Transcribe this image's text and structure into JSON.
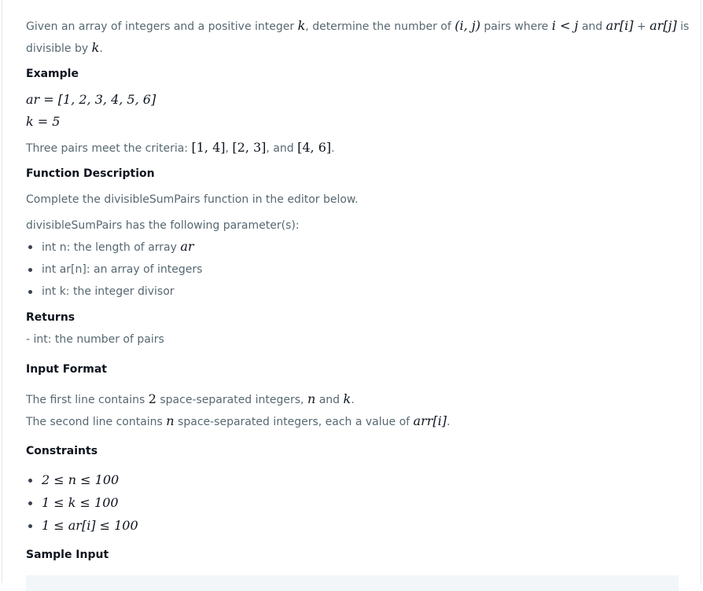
{
  "intro": {
    "t1": "Given an array of integers and a positive integer ",
    "k": "k",
    "t2": ", determine the number of ",
    "pair": "(i, j)",
    "t3": " pairs where ",
    "cond": "i < j",
    "t4": " and ",
    "ari": "ar[i]",
    "plus": " + ",
    "arj": "ar[j]",
    "t5": " is",
    "line2a": "divisible by ",
    "line2k": "k",
    "line2b": "."
  },
  "example": {
    "heading": "Example",
    "ar_line": "ar = [1, 2, 3, 4, 5, 6]",
    "k_line": "k = 5",
    "pairs_text": "Three pairs meet the criteria: ",
    "p1": "[1, 4]",
    "c1": ", ",
    "p2": "[2, 3]",
    "c2": ", and ",
    "p3": "[4, 6]",
    "end": "."
  },
  "function_description": {
    "heading": "Function Description",
    "text": "Complete the divisibleSumPairs function in the editor below.",
    "params_intro": "divisibleSumPairs has the following parameter(s):",
    "param1_text": "int n: the length of array ",
    "param1_var": "ar",
    "param2": "int ar[n]: an array of integers",
    "param3": "int k: the integer divisor"
  },
  "returns": {
    "heading": "Returns",
    "text": "- int: the number of pairs"
  },
  "input_format": {
    "heading": "Input Format",
    "l1a": "The first line contains ",
    "l1num": "2",
    "l1b": " space-separated integers, ",
    "l1n": "n",
    "l1c": " and ",
    "l1k": "k",
    "l1d": ".",
    "l2a": "The second line contains ",
    "l2n": "n",
    "l2b": " space-separated integers, each a value of ",
    "l2arr": "arr[i]",
    "l2c": "."
  },
  "constraints": {
    "heading": "Constraints",
    "c1": "2 ≤ n ≤ 100",
    "c2": "1 ≤ k ≤ 100",
    "c3": "1 ≤ ar[i] ≤ 100"
  },
  "sample_input": {
    "heading": "Sample Input"
  }
}
